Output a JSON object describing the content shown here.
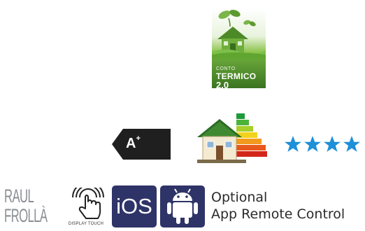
{
  "conto_termico": {
    "line1": "CONTO",
    "line2": "TERMICO",
    "line3": "2.0",
    "icon": "green-house-icon"
  },
  "energy": {
    "class_label": "A",
    "class_suffix": "+",
    "house_icon": "energy-efficiency-house-icon"
  },
  "rating": {
    "stars": 4,
    "color": "#1e90d8"
  },
  "brand": {
    "logo_line1": "RAUL",
    "logo_line2": "FROLLÀ"
  },
  "features": {
    "display_touch_label": "DISPLAY TOUCH",
    "ios_label": "iOS",
    "android_icon": "android-icon",
    "optional_line1": "Optional",
    "optional_line2": "App Remote Control"
  },
  "colors": {
    "badge_green": "#5a9c2c",
    "platform_navy": "#2e3368",
    "energy_label_bg": "#222222"
  }
}
